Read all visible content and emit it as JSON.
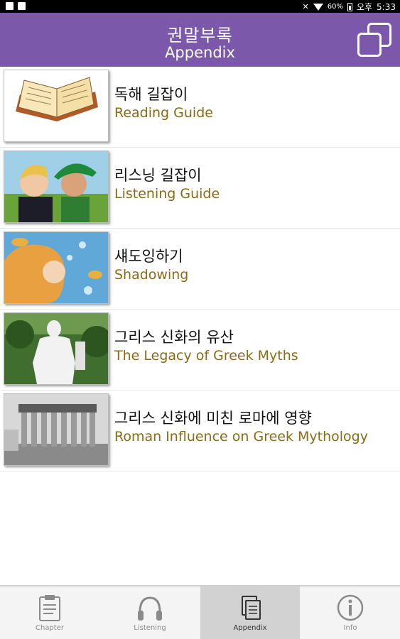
{
  "status_bar": {
    "battery": "60%",
    "ampm": "오후",
    "time": "5:33"
  },
  "header": {
    "title_ko": "권말부록",
    "title_en": "Appendix",
    "action_icon": "windows-stack-icon"
  },
  "items": [
    {
      "ko": "독해 길잡이",
      "en": "Reading Guide"
    },
    {
      "ko": "리스닝 길잡이",
      "en": "Listening Guide"
    },
    {
      "ko": "섀도잉하기",
      "en": "Shadowing"
    },
    {
      "ko": "그리스 신화의 유산",
      "en": "The Legacy of Greek Myths"
    },
    {
      "ko": "그리스 신화에 미친 로마에 영향",
      "en": "Roman Influence on Greek Mythology"
    }
  ],
  "tabs": [
    {
      "label": "Chapter",
      "icon": "clipboard-icon",
      "active": false
    },
    {
      "label": "Listening",
      "icon": "headphones-icon",
      "active": false
    },
    {
      "label": "Appendix",
      "icon": "documents-icon",
      "active": true
    },
    {
      "label": "Info",
      "icon": "info-icon",
      "active": false
    }
  ],
  "colors": {
    "header_bg": "#7b58aa",
    "english_subtitle": "#8a6a14"
  }
}
